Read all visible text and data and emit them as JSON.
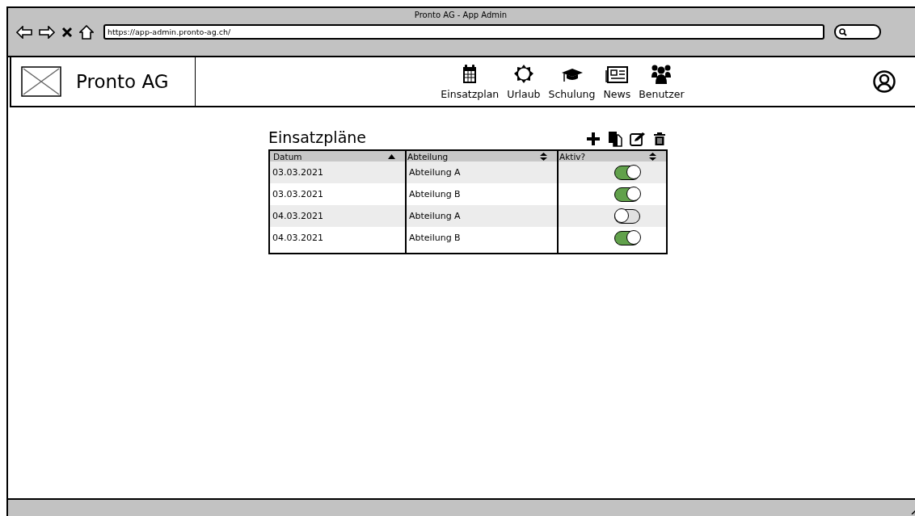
{
  "window": {
    "title": "Pronto AG - App Admin"
  },
  "browser": {
    "url": "https://app-admin.pronto-ag.ch/"
  },
  "app": {
    "name": "Pronto AG"
  },
  "nav": [
    {
      "label": "Einsatzplan"
    },
    {
      "label": "Urlaub"
    },
    {
      "label": "Schulung"
    },
    {
      "label": "News"
    },
    {
      "label": "Benutzer"
    }
  ],
  "page": {
    "title": "Einsatzpläne"
  },
  "table": {
    "columns": [
      {
        "label": "Datum",
        "sorted": true
      },
      {
        "label": "Abteilung",
        "sorted": false
      },
      {
        "label": "Aktiv?",
        "sorted": false
      }
    ],
    "rows": [
      {
        "datum": "03.03.2021",
        "abteilung": "Abteilung A",
        "on": true
      },
      {
        "datum": "03.03.2021",
        "abteilung": "Abteilung B",
        "on": true
      },
      {
        "datum": "04.03.2021",
        "abteilung": "Abteilung A",
        "on": false
      },
      {
        "datum": "04.03.2021",
        "abteilung": "Abteilung B",
        "on": true
      }
    ]
  }
}
